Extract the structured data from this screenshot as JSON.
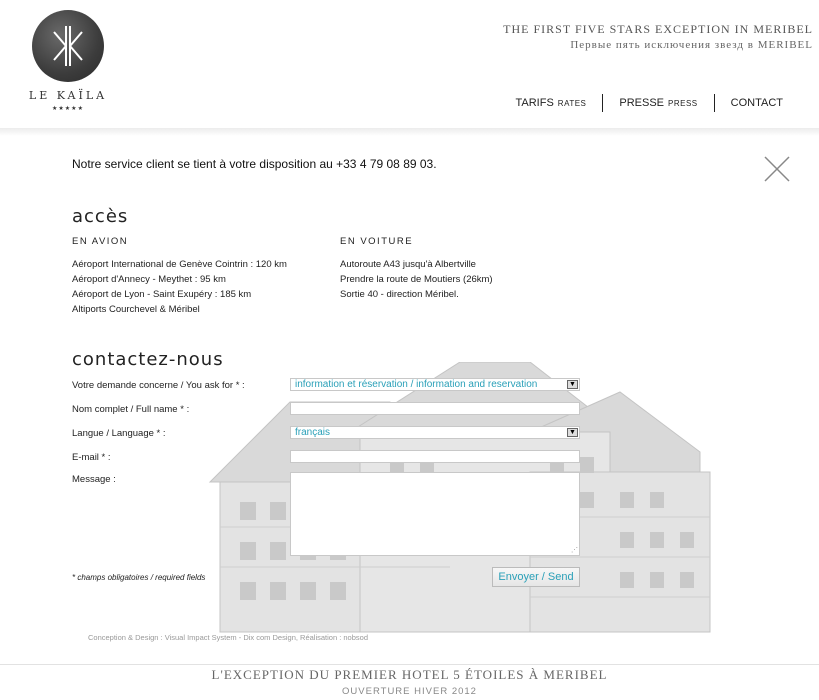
{
  "brand": {
    "name": "LE KAÏLA",
    "stars": "★★★★★"
  },
  "header": {
    "tagline_en": "THE FIRST FIVE STARS EXCEPTION IN MERIBEL",
    "tagline_ru": "Первые пять исключения звезд в MERIBEL",
    "nav": [
      {
        "label": "TARIFS",
        "sub": "RATES"
      },
      {
        "label": "PRESSE",
        "sub": "PRESS"
      },
      {
        "label": "CONTACT",
        "sub": ""
      }
    ]
  },
  "main": {
    "service_text": "Notre service client se tient à votre disposition au +33 4 79 08 89 03.",
    "acces": {
      "title": "accès",
      "avion": {
        "title": "EN AVION",
        "lines": [
          "Aéroport International de Genève Cointrin : 120 km",
          "Aéroport d'Annecy - Meythet : 95 km",
          "Aéroport de Lyon - Saint Exupéry : 185 km",
          "Altiports Courchevel & Méribel"
        ]
      },
      "voiture": {
        "title": "EN VOITURE",
        "lines": [
          "Autoroute A43 jusqu'à Albertville",
          "Prendre la route de Moutiers (26km)",
          "Sortie 40 - direction Méribel."
        ]
      }
    },
    "contact": {
      "title": "contactez-nous",
      "fields": {
        "demande_label": "Votre demande concerne / You ask for * :",
        "demande_value": "information et réservation / information and reservation",
        "name_label": "Nom complet / Full name * :",
        "language_label": "Langue / Language * :",
        "language_value": "français",
        "email_label": "E-mail * :",
        "message_label": "Message :"
      },
      "required_note": "* champs obligatoires / required fields",
      "send_label": "Envoyer / Send"
    },
    "credits": "Conception & Design : Visual Impact System - Dix com Design, Réalisation : nobsod"
  },
  "footer": {
    "title": "L'EXCEPTION DU PREMIER HOTEL 5 ÉTOILES À MERIBEL",
    "subtitle": "OUVERTURE HIVER 2012"
  },
  "colors": {
    "accent": "#2aa0b8",
    "text": "#222222",
    "muted": "#999999"
  }
}
